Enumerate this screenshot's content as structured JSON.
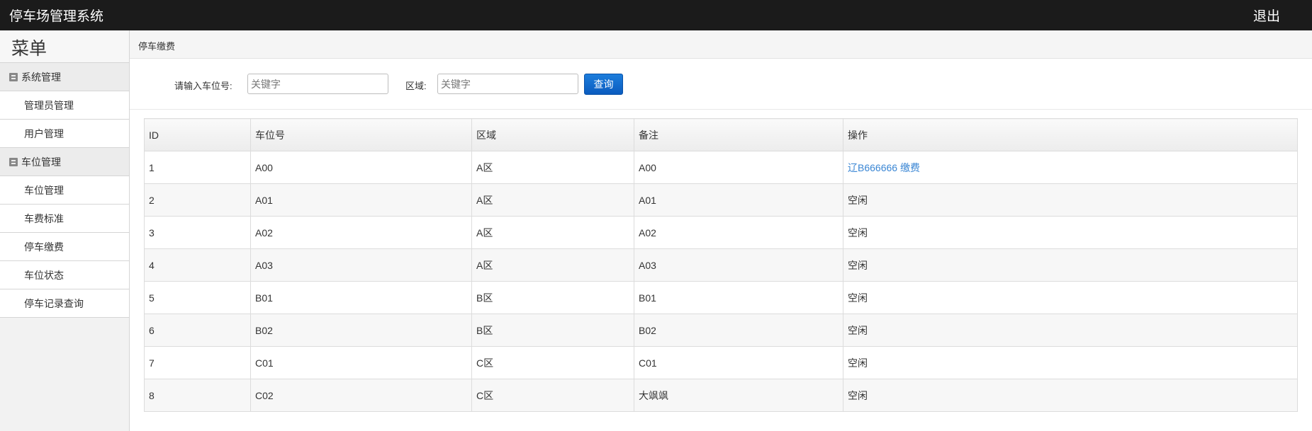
{
  "header": {
    "title": "停车场管理系统",
    "logout": "退出"
  },
  "sidebar": {
    "title": "菜单",
    "groups": [
      {
        "label": "系统管理",
        "items": [
          "管理员管理",
          "用户管理"
        ]
      },
      {
        "label": "车位管理",
        "items": [
          "车位管理",
          "车费标准",
          "停车缴费",
          "车位状态",
          "停车记录查询"
        ]
      }
    ]
  },
  "breadcrumb": "停车缴费",
  "search": {
    "space_label": "请输入车位号:",
    "space_placeholder": "关键字",
    "area_label": "区域:",
    "area_placeholder": "关键字",
    "button": "查询"
  },
  "table": {
    "headers": [
      "ID",
      "车位号",
      "区域",
      "备注",
      "操作"
    ],
    "rows": [
      [
        "1",
        "A00",
        "A区",
        "A00",
        "辽B666666 缴费"
      ],
      [
        "2",
        "A01",
        "A区",
        "A01",
        "空闲"
      ],
      [
        "3",
        "A02",
        "A区",
        "A02",
        "空闲"
      ],
      [
        "4",
        "A03",
        "A区",
        "A03",
        "空闲"
      ],
      [
        "5",
        "B01",
        "B区",
        "B01",
        "空闲"
      ],
      [
        "6",
        "B02",
        "B区",
        "B02",
        "空闲"
      ],
      [
        "7",
        "C01",
        "C区",
        "C01",
        "空闲"
      ],
      [
        "8",
        "C02",
        "C区",
        "大飒飒",
        "空闲"
      ]
    ]
  }
}
